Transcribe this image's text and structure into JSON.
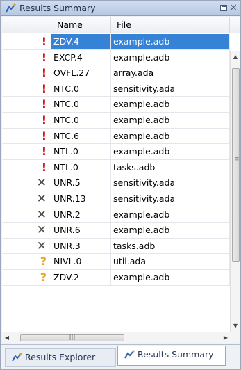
{
  "panel": {
    "title": "Results Summary",
    "icon": "results-icon",
    "restore_icon": "restore-icon",
    "close_symbol": "×"
  },
  "table": {
    "columns": [
      "",
      "Name",
      "File"
    ],
    "rows": [
      {
        "icon": "red-exclamation-icon",
        "glyph": "!",
        "name": "ZDV.4",
        "file": "example.adb",
        "selected": true
      },
      {
        "icon": "red-exclamation-icon",
        "glyph": "!",
        "name": "EXCP.4",
        "file": "example.adb"
      },
      {
        "icon": "red-exclamation-icon",
        "glyph": "!",
        "name": "OVFL.27",
        "file": "array.ada"
      },
      {
        "icon": "red-exclamation-icon",
        "glyph": "!",
        "name": "NTC.0",
        "file": "sensitivity.ada"
      },
      {
        "icon": "red-exclamation-icon",
        "glyph": "!",
        "name": "NTC.0",
        "file": "example.adb"
      },
      {
        "icon": "red-exclamation-icon",
        "glyph": "!",
        "name": "NTC.0",
        "file": "example.adb"
      },
      {
        "icon": "red-exclamation-icon",
        "glyph": "!",
        "name": "NTC.6",
        "file": "example.adb"
      },
      {
        "icon": "red-exclamation-icon",
        "glyph": "!",
        "name": "NTL.0",
        "file": "example.adb"
      },
      {
        "icon": "red-exclamation-icon",
        "glyph": "!",
        "name": "NTL.0",
        "file": "tasks.adb"
      },
      {
        "icon": "gray-x-icon",
        "glyph": "✕",
        "name": "UNR.5",
        "file": "sensitivity.ada"
      },
      {
        "icon": "gray-x-icon",
        "glyph": "✕",
        "name": "UNR.13",
        "file": "sensitivity.ada"
      },
      {
        "icon": "gray-x-icon",
        "glyph": "✕",
        "name": "UNR.2",
        "file": "example.adb"
      },
      {
        "icon": "gray-x-icon",
        "glyph": "✕",
        "name": "UNR.6",
        "file": "example.adb"
      },
      {
        "icon": "gray-x-icon",
        "glyph": "✕",
        "name": "UNR.3",
        "file": "tasks.adb"
      },
      {
        "icon": "orange-question-icon",
        "glyph": "?",
        "name": "NIVL.0",
        "file": "util.ada"
      },
      {
        "icon": "orange-question-icon",
        "glyph": "?",
        "name": "ZDV.2",
        "file": "example.adb"
      }
    ]
  },
  "tabs": [
    {
      "label": "Results Explorer",
      "icon": "results-icon",
      "active": false
    },
    {
      "label": "Results Summary",
      "icon": "results-icon",
      "active": true
    }
  ],
  "colors": {
    "selection": "#3582d6",
    "red": "#d11616",
    "gray": "#474747",
    "orange": "#f0a020"
  }
}
